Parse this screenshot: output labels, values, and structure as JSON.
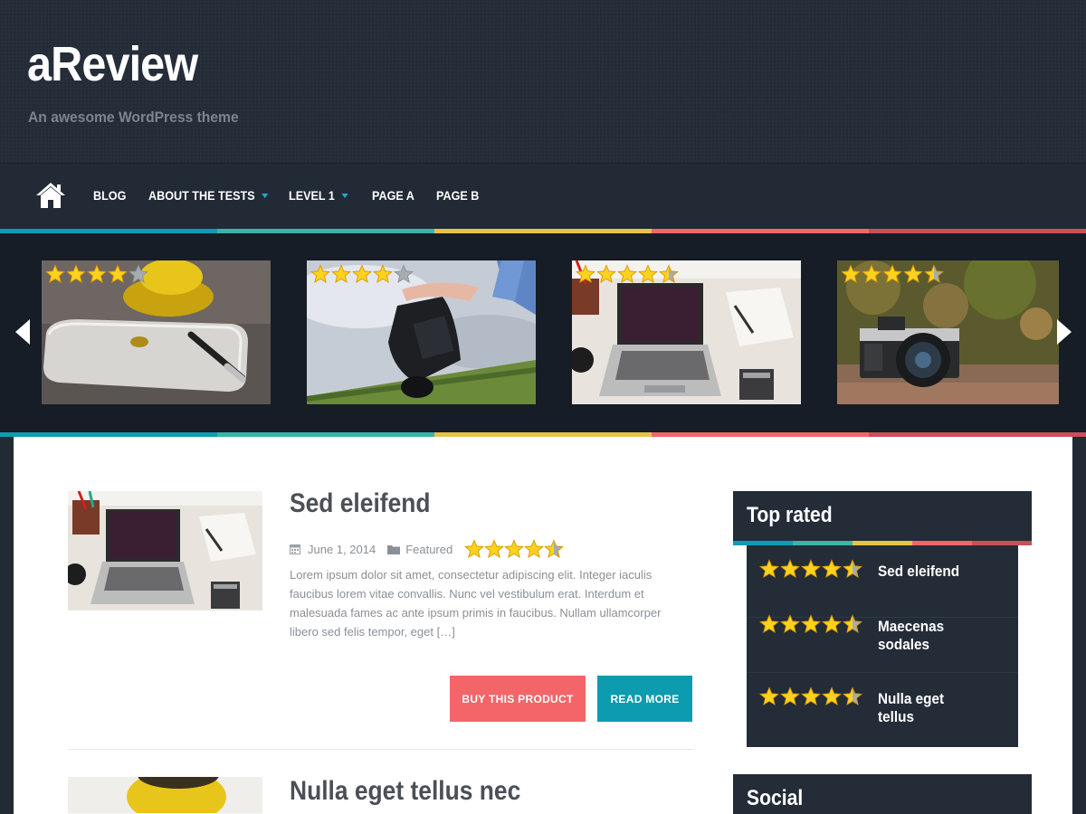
{
  "site": {
    "title": "aReview",
    "description": "An awesome WordPress theme"
  },
  "nav": {
    "home_icon": "home-icon",
    "items": [
      {
        "label": "BLOG",
        "has_dropdown": false
      },
      {
        "label": "ABOUT THE TESTS",
        "has_dropdown": true
      },
      {
        "label": "LEVEL 1",
        "has_dropdown": true
      },
      {
        "label": "PAGE A",
        "has_dropdown": false
      },
      {
        "label": "PAGE B",
        "has_dropdown": false
      }
    ]
  },
  "colors": {
    "stripe": [
      "#0f9cb2",
      "#3bb4a8",
      "#e9c14a",
      "#f0676b",
      "#c8505a"
    ],
    "header_bg": "#232c37",
    "buy_button": "#f36568",
    "read_button": "#0d9bb0"
  },
  "slider": {
    "prev_icon": "arrow-left-icon",
    "next_icon": "arrow-right-icon",
    "slides": [
      {
        "image": "ipad-coffee-photo",
        "rating": 4
      },
      {
        "image": "camera-hand-photo",
        "rating": 4
      },
      {
        "image": "laptop-desk-photo",
        "rating": 4.5
      },
      {
        "image": "vintage-camera-photo",
        "rating": 4.5
      }
    ]
  },
  "posts": [
    {
      "title": "Sed eleifend",
      "date": "June 1, 2014",
      "category": "Featured",
      "rating": 4.5,
      "excerpt": "Lorem ipsum dolor sit amet, consectetur adipiscing elit. Integer iaculis faucibus lorem vitae convallis. Nunc vel vestibulum erat. Interdum et malesuada fames ac ante ipsum primis in faucibus. Nullam ullamcorper libero sed felis tempor, eget […]",
      "buy_label": "BUY THIS PRODUCT",
      "read_label": "READ MORE"
    },
    {
      "title": "Nulla eget tellus nec"
    }
  ],
  "sidebar": {
    "top_rated": {
      "title": "Top rated",
      "items": [
        {
          "name": "Sed eleifend",
          "rating": 4.5
        },
        {
          "name": "Maecenas sodales",
          "rating": 4.5
        },
        {
          "name": "Nulla eget tellus",
          "rating": 4.5
        }
      ]
    },
    "social": {
      "title": "Social"
    }
  }
}
